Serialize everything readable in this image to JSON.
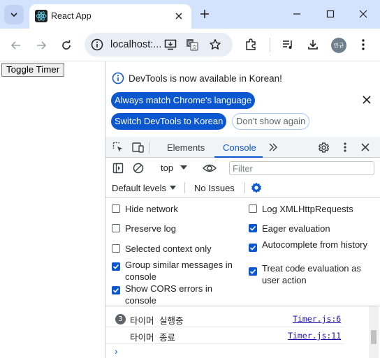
{
  "tab": {
    "title": "React App",
    "favicon": "react-logo-icon"
  },
  "omnibox": {
    "url": "localhost:..."
  },
  "profile": {
    "initials": "인규"
  },
  "page": {
    "toggle_button": "Toggle Timer"
  },
  "devtools": {
    "infobar": {
      "message": "DevTools is now available in Korean!",
      "match_language_button": "Always match Chrome's language",
      "switch_button": "Switch DevTools to Korean",
      "dont_show_button": "Don't show again"
    },
    "tabs": [
      {
        "label": "Elements",
        "active": false
      },
      {
        "label": "Console",
        "active": true
      }
    ],
    "console_toolbar": {
      "context": "top",
      "filter_placeholder": "Filter"
    },
    "levels_bar": {
      "levels": "Default levels",
      "issues": "No Issues"
    },
    "settings": {
      "left": [
        {
          "label": "Hide network",
          "checked": false
        },
        {
          "label": "Preserve log",
          "checked": false
        },
        {
          "label": "Selected context only",
          "checked": false
        },
        {
          "label": "Group similar messages in console",
          "checked": true
        },
        {
          "label": "Show CORS errors in console",
          "checked": true
        }
      ],
      "right": [
        {
          "label": "Log XMLHttpRequests",
          "checked": false
        },
        {
          "label": "Eager evaluation",
          "checked": true
        },
        {
          "label": "Autocomplete from history",
          "checked": true
        },
        {
          "label": "Treat code evaluation as user action",
          "checked": true
        }
      ]
    },
    "console_output": [
      {
        "count": "3",
        "message": "타이머 실행중",
        "source": "Timer.js:6"
      },
      {
        "count": "",
        "message": "타이머 종료",
        "source": "Timer.js:11"
      }
    ],
    "prompt": "›"
  },
  "colors": {
    "accent": "#0b57d0",
    "tabstrip": "#d3e3fd"
  }
}
